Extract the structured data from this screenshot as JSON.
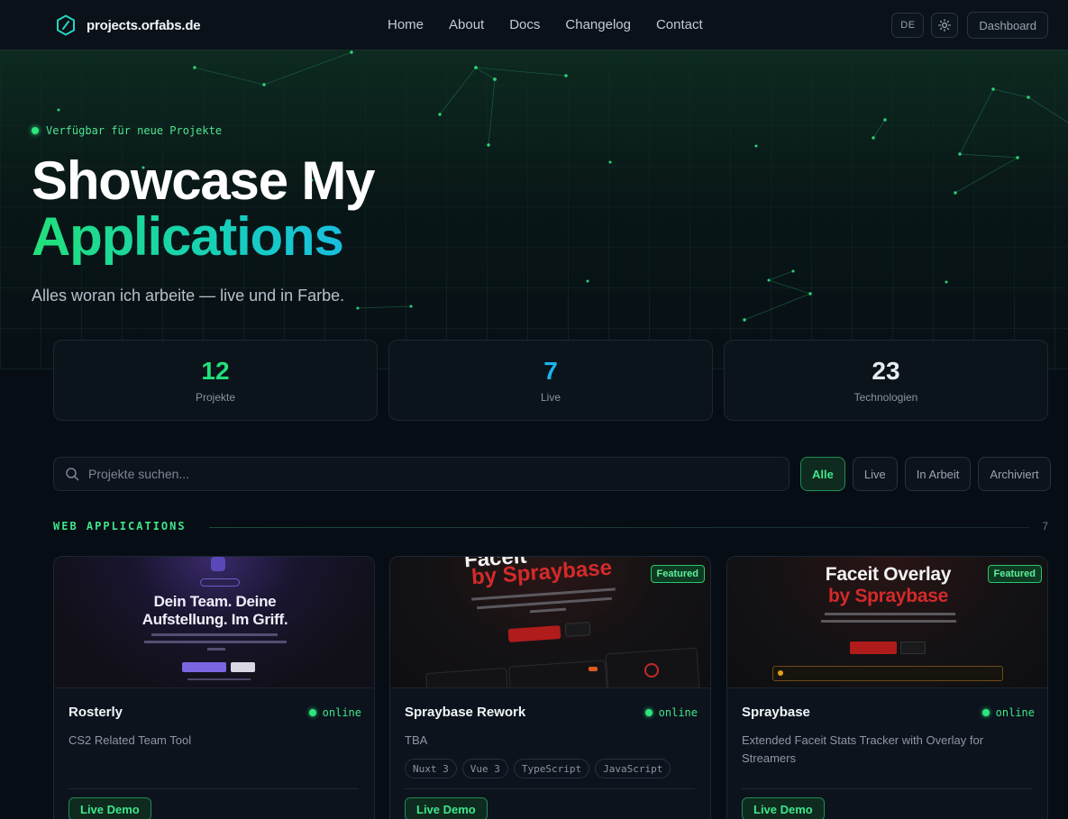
{
  "nav": {
    "brand": "projects.orfabs.de",
    "links": [
      "Home",
      "About",
      "Docs",
      "Changelog",
      "Contact"
    ],
    "lang": "DE",
    "dashboard": "Dashboard"
  },
  "hero": {
    "status": "Verfügbar für neue Projekte",
    "title_line1": "Showcase My",
    "title_line2": "Applications",
    "subtitle": "Alles woran ich arbeite — live und in Farbe."
  },
  "stats": [
    {
      "value": "12",
      "label": "Projekte",
      "color": "#22e07a"
    },
    {
      "value": "7",
      "label": "Live",
      "color": "#19b5ee"
    },
    {
      "value": "23",
      "label": "Technologien",
      "color": "#e8edf2"
    }
  ],
  "search": {
    "placeholder": "Projekte suchen..."
  },
  "filters": [
    {
      "label": "Alle",
      "active": true
    },
    {
      "label": "Live",
      "active": false
    },
    {
      "label": "In Arbeit",
      "active": false
    },
    {
      "label": "Archiviert",
      "active": false
    }
  ],
  "section": {
    "title": "WEB APPLICATIONS",
    "count": "7"
  },
  "cards": [
    {
      "title": "Rosterly",
      "status": "online",
      "description": "CS2 Related Team Tool",
      "tags": [],
      "button": "Live Demo",
      "thumb": {
        "headline1": "Dein Team. Deine",
        "headline2": "Aufstellung. Im Griff."
      }
    },
    {
      "title": "Spraybase Rework",
      "status": "online",
      "description": "TBA",
      "tags": [
        "Nuxt 3",
        "Vue 3",
        "TypeScript",
        "JavaScript"
      ],
      "button": "Live Demo",
      "featured": "Featured",
      "thumb": {
        "headline1": "Faceit",
        "headline2": "by Spraybase"
      }
    },
    {
      "title": "Spraybase",
      "status": "online",
      "description": "Extended Faceit Stats Tracker with Overlay for Streamers",
      "tags": [],
      "button": "Live Demo",
      "featured": "Featured",
      "thumb": {
        "headline1": "Faceit Overlay",
        "headline2": "by Spraybase"
      }
    }
  ],
  "colors": {
    "accent_green": "#22e07a",
    "accent_cyan": "#19b5ee",
    "background": "#070d14"
  }
}
